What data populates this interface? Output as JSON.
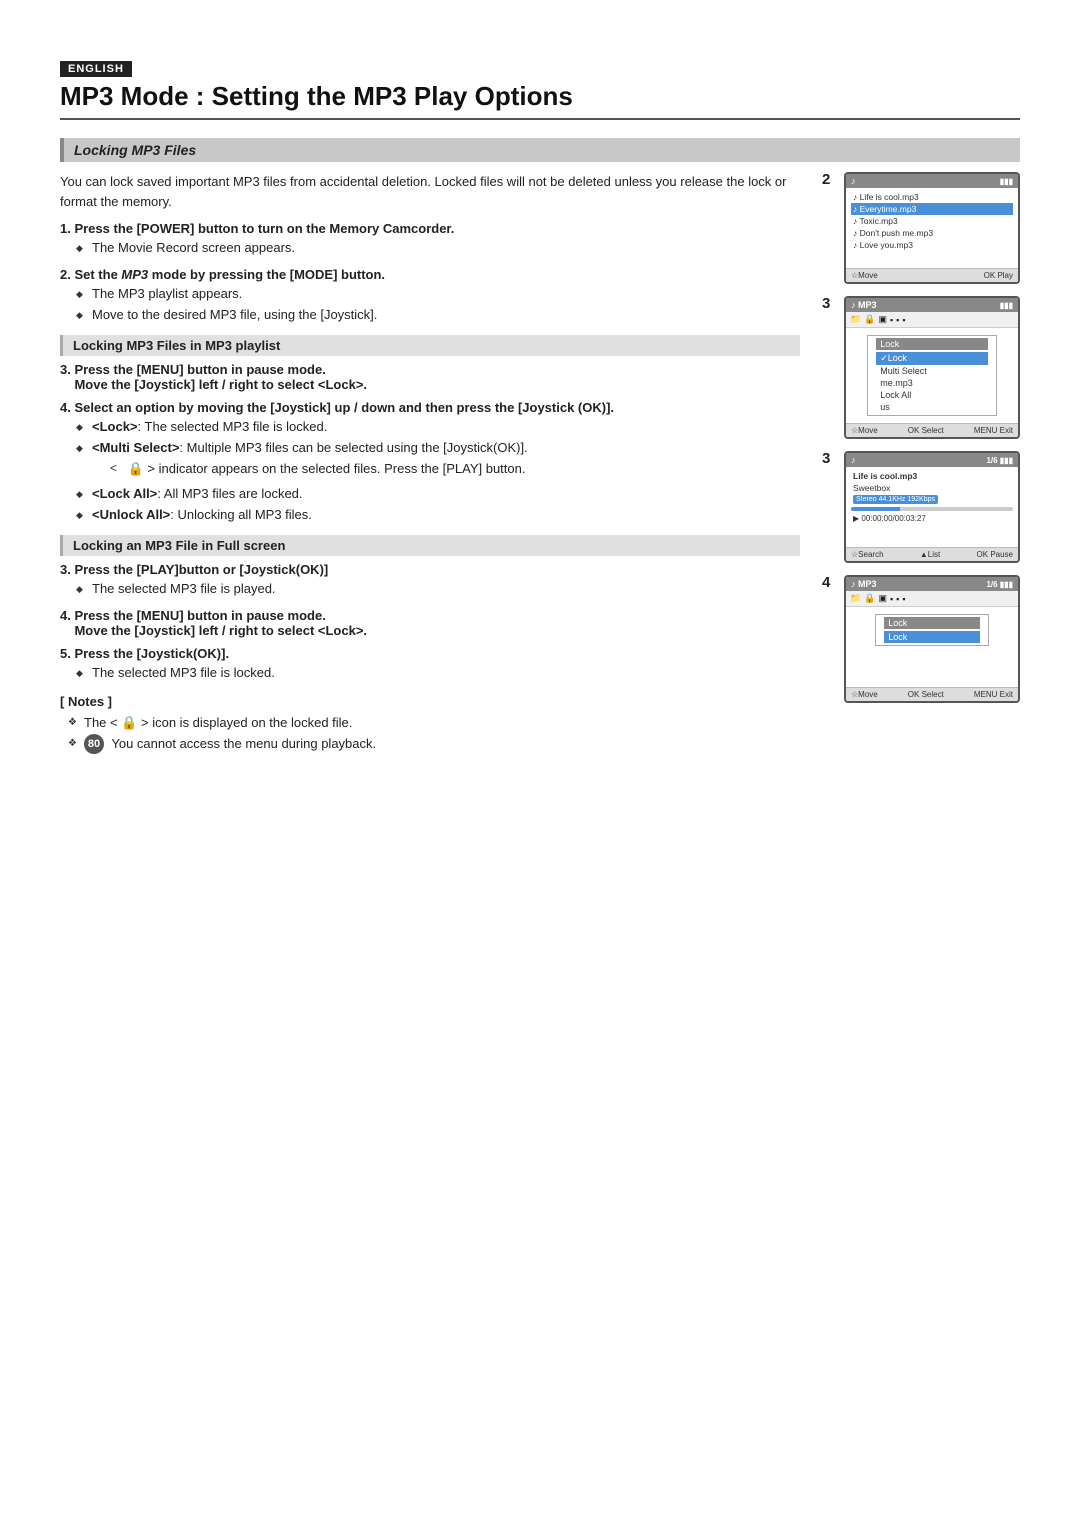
{
  "badge": {
    "label": "ENGLISH"
  },
  "title": "MP3 Mode : Setting the MP3 Play Options",
  "section": {
    "title": "Locking MP3 Files",
    "intro": "You can lock saved important MP3 files from accidental deletion. Locked files will not be deleted unless you release the lock or format the memory."
  },
  "steps": [
    {
      "number": "1.",
      "bold_text": "Press the [POWER] button to turn on the Memory Camcorder.",
      "bullets": [
        "The Movie Record screen appears."
      ]
    },
    {
      "number": "2.",
      "bold_part": "Set the ",
      "italic_part": "MP3",
      "bold_part2": " mode by pressing the [MODE] button.",
      "bullets": [
        "The MP3 playlist appears.",
        "Move to the desired MP3 file, using the [Joystick]."
      ]
    }
  ],
  "subsection1": {
    "title": "Locking MP3 Files in MP3 playlist"
  },
  "steps2": [
    {
      "number": "3.",
      "line1": "Press the [MENU] button in pause mode.",
      "line2": "Move the [Joystick] left / right to select <Lock>."
    },
    {
      "number": "4.",
      "line1": "Select an option by moving the [Joystick] up / down and then press the [Joystick (OK)].",
      "bullets": [
        "<Lock>: The selected MP3 file is locked.",
        "<Multi Select>: Multiple MP3 files can be selected using the [Joystick(OK)].",
        "< 🔒 > indicator appears on the selected files. Press the [PLAY] button.",
        "<Lock All>: All MP3 files are locked.",
        "<Unlock All>: Unlocking all MP3 files."
      ]
    }
  ],
  "subsection2": {
    "title": "Locking an MP3 File in Full screen"
  },
  "steps3": [
    {
      "number": "3.",
      "line1": "Press the [PLAY]button or [Joystick(OK)]",
      "bullets": [
        "The selected MP3 file is played."
      ]
    },
    {
      "number": "4.",
      "line1": "Press the [MENU] button in pause mode.",
      "line2": "Move the [Joystick] left / right to select <Lock>."
    },
    {
      "number": "5.",
      "line1": "Press the [Joystick(OK)].",
      "bullets": [
        "The selected MP3 file is locked."
      ]
    }
  ],
  "notes": {
    "title": "[ Notes ]",
    "items": [
      "The < 🔒 > icon is displayed on the locked file.",
      "You cannot access the menu during playback."
    ]
  },
  "page_number": "80",
  "screens": [
    {
      "number": "2",
      "header_title": "♪",
      "header_icons": "▮▮",
      "tracks": [
        "♪  Life is cool.mp3",
        "♪  Everytime.mp3",
        "♪  Toxic.mp3",
        "♪  Don't push me.mp3",
        "♪  Love you.mp3"
      ],
      "selected_index": 1,
      "footer_left": "☆Move",
      "footer_right": "OK Play"
    },
    {
      "number": "3",
      "header_title": "♪ MP3",
      "header_icons": "▮▮",
      "toolbar_icons": [
        "📁",
        "🔒",
        "▣",
        "▪",
        "▪",
        "▪"
      ],
      "menu_title": "Lock",
      "menu_items": [
        "Lock",
        "Multi Select",
        "me.mp3",
        "Lock All",
        "us"
      ],
      "selected_menu": 0,
      "footer_left": "☆Move",
      "footer_mid": "OK Select",
      "footer_right": "MENU Exit"
    },
    {
      "number": "3",
      "header_title": "♪",
      "header_right": "1/6 ▮▮",
      "song_title": "Life is cool.mp3",
      "artist": "Sweetbox",
      "stereo_label": "Stereo 44.1KHz 192Kbps",
      "time_elapsed": "▶ 00:00:00/00:03:27",
      "footer_left": "☆Search",
      "footer_mid": "▲List",
      "footer_right": "OK Pause"
    },
    {
      "number": "4",
      "header_title": "♪ MP3",
      "header_right": "1/6 ▮▮",
      "toolbar_icons": [
        "📁",
        "🔒",
        "▣",
        "▪",
        "▪",
        "▪"
      ],
      "menu_title": "Lock",
      "menu_items": [
        "Lock"
      ],
      "footer_left": "☆Move",
      "footer_mid": "OK Select",
      "footer_right": "MENU Exit"
    }
  ]
}
